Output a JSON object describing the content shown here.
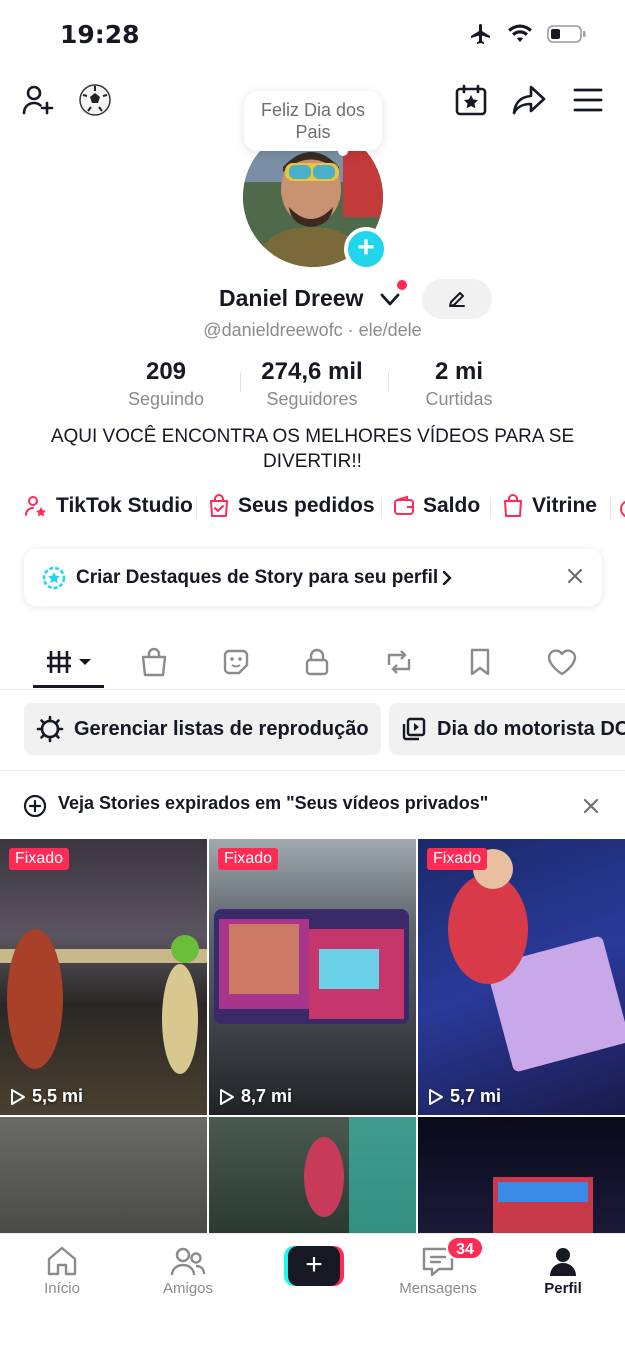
{
  "status_bar": {
    "time": "19:28"
  },
  "profile": {
    "note": "Feliz Dia dos Pais",
    "name": "Daniel Dreew",
    "handle": "@danieldreewofc · ele/dele",
    "bio": "AQUI VOCÊ ENCONTRA OS MELHORES VÍDEOS PARA SE DIVERTIR!!"
  },
  "stats": [
    {
      "value": "209",
      "label": "Seguindo"
    },
    {
      "value": "274,6 mil",
      "label": "Seguidores"
    },
    {
      "value": "2 mi",
      "label": "Curtidas"
    }
  ],
  "quick_links": [
    {
      "label": "TikTok Studio",
      "icon": "person-star-icon"
    },
    {
      "label": "Seus pedidos",
      "icon": "order-bag-icon"
    },
    {
      "label": "Saldo",
      "icon": "wallet-icon"
    },
    {
      "label": "Vitrine",
      "icon": "shop-bag-icon"
    }
  ],
  "story_banner": {
    "text": "Criar Destaques de Story para seu perfil"
  },
  "playlists": [
    {
      "label": "Gerenciar listas de reprodução",
      "icon": "gear-icon"
    },
    {
      "label": "Dia do motorista DC",
      "icon": "playlist-icon"
    }
  ],
  "expired_stories": {
    "text": "Veja Stories expirados em \"Seus vídeos privados\""
  },
  "videos": [
    {
      "pinned": "Fixado",
      "views": "5,5 mi"
    },
    {
      "pinned": "Fixado",
      "views": "8,7 mi"
    },
    {
      "pinned": "Fixado",
      "views": "5,7 mi"
    },
    {
      "pinned": "",
      "views": ""
    },
    {
      "pinned": "",
      "views": ""
    },
    {
      "pinned": "",
      "views": ""
    }
  ],
  "bottom_nav": {
    "home": "Início",
    "friends": "Amigos",
    "inbox": "Mensagens",
    "inbox_badge": "34",
    "profile": "Perfil"
  },
  "colors": {
    "accent": "#fe2c55",
    "cyan": "#20d5ec",
    "text": "#161823",
    "muted": "#8a8b91"
  }
}
